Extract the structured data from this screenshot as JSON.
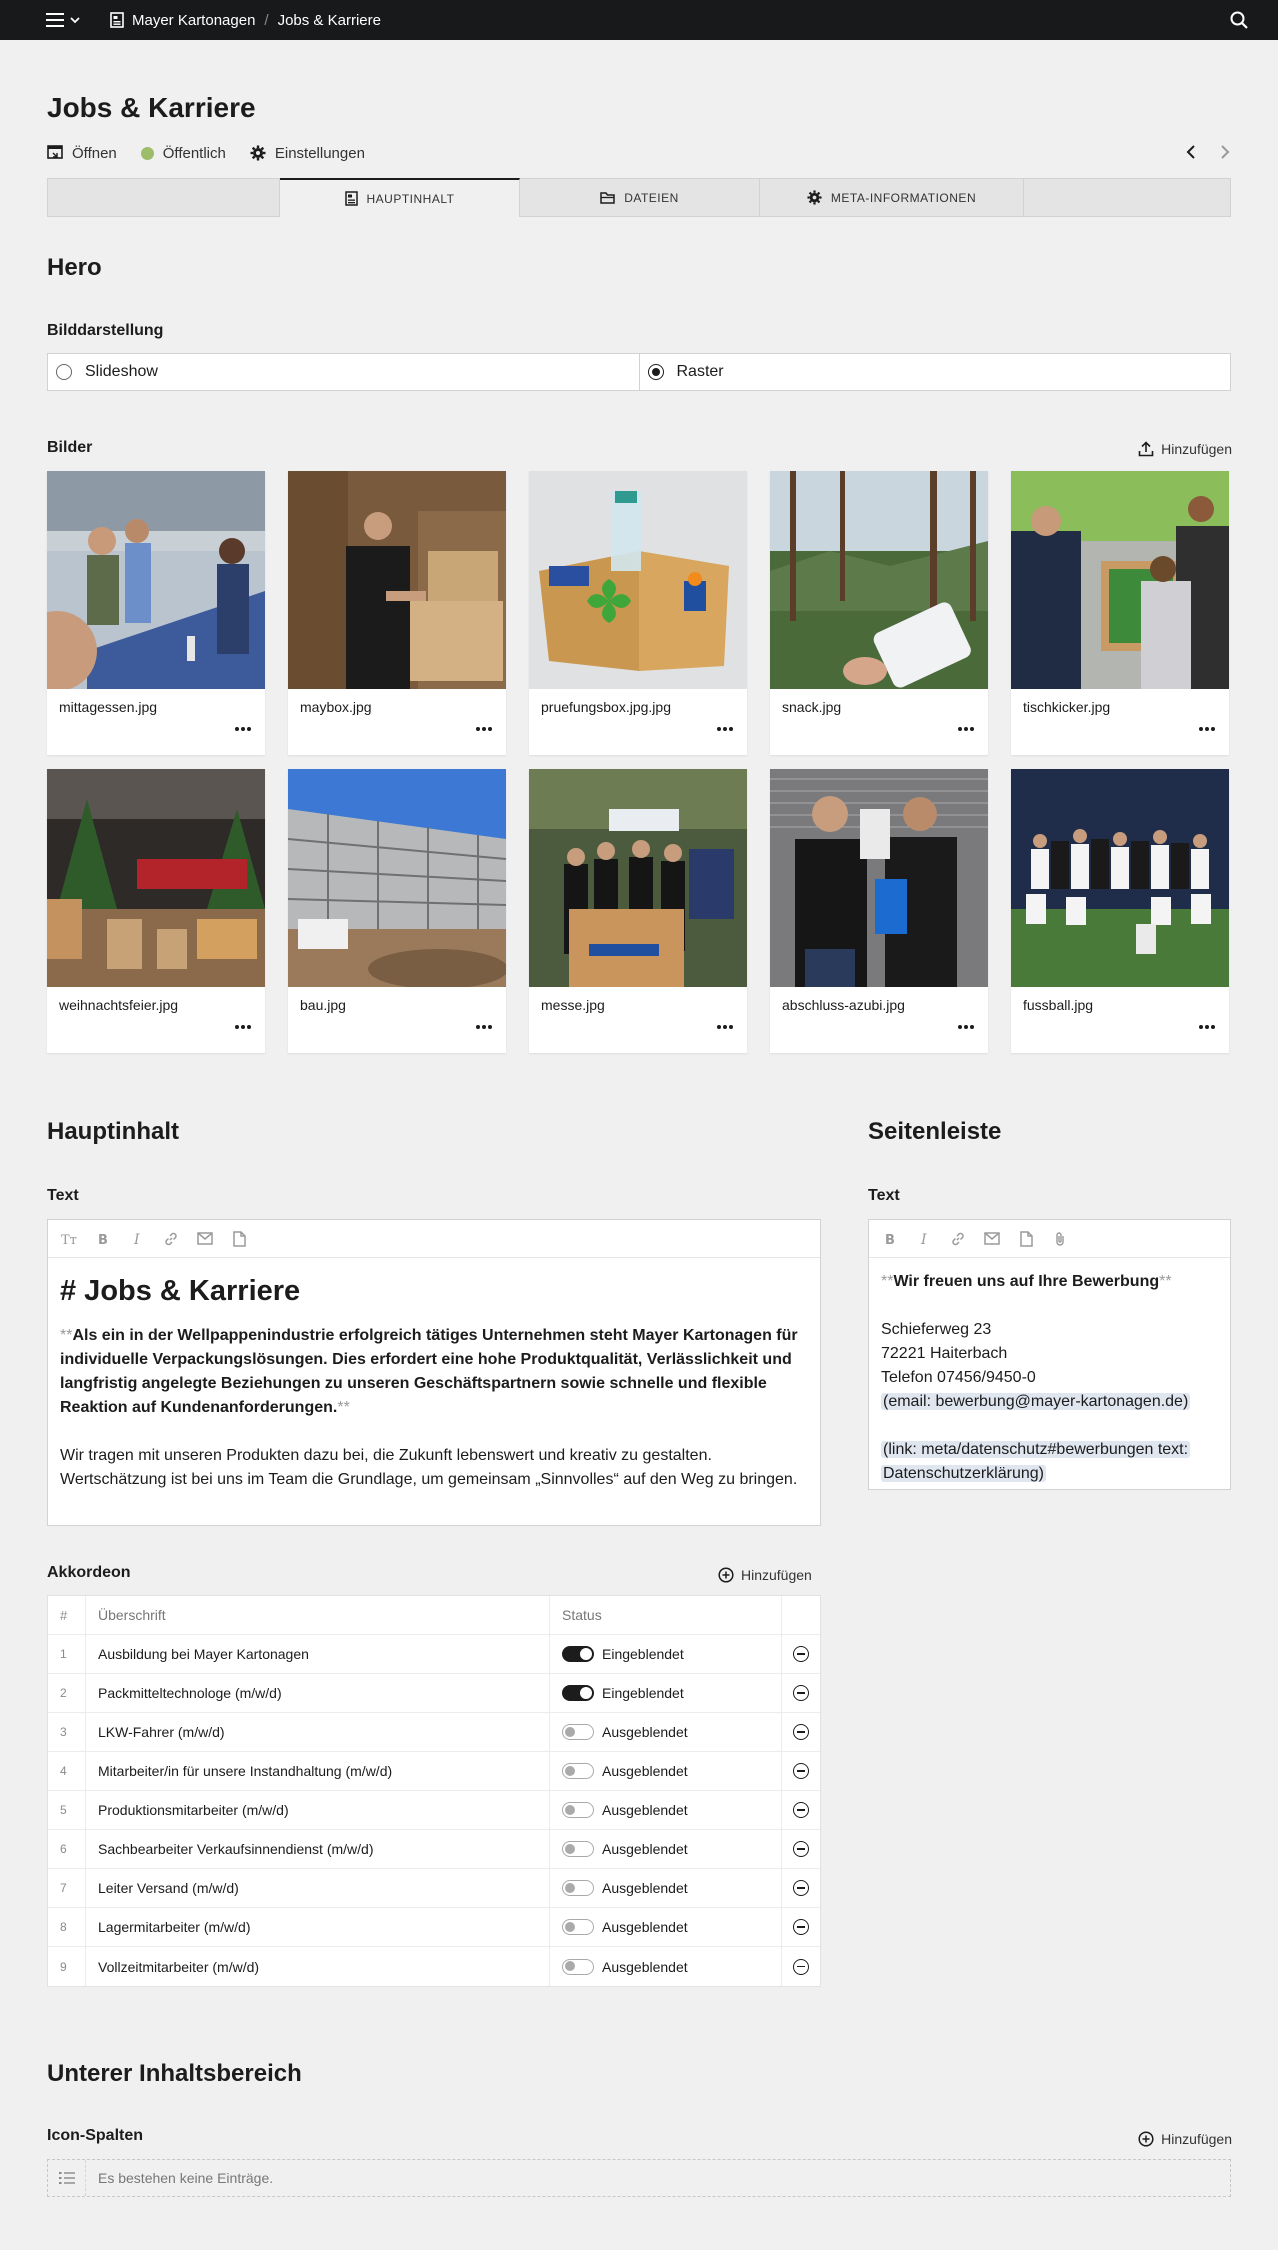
{
  "topbar": {
    "breadcrumb": [
      "Mayer Kartonagen",
      "Jobs & Karriere"
    ]
  },
  "page": {
    "title": "Jobs & Karriere",
    "actions": {
      "open": "Öffnen",
      "public": "Öffentlich",
      "settings": "Einstellungen"
    },
    "status_color": "#9dbd6b"
  },
  "tabs": [
    {
      "label": "HAUPTINHALT",
      "icon": "document-icon",
      "active": true
    },
    {
      "label": "DATEIEN",
      "icon": "folder-icon",
      "active": false
    },
    {
      "label": "META-INFORMATIONEN",
      "icon": "gear-icon",
      "active": false
    }
  ],
  "hero": {
    "section_title": "Hero",
    "display_label": "Bilddarstellung",
    "options": [
      "Slideshow",
      "Raster"
    ],
    "selected": "Raster",
    "images_label": "Bilder",
    "add_label": "Hinzufügen",
    "images": [
      "mittagessen.jpg",
      "maybox.jpg",
      "pruefungsbox.jpg.jpg",
      "snack.jpg",
      "tischkicker.jpg",
      "weihnachtsfeier.jpg",
      "bau.jpg",
      "messe.jpg",
      "abschluss-azubi.jpg",
      "fussball.jpg"
    ]
  },
  "main": {
    "section_title": "Hauptinhalt",
    "text_label": "Text",
    "heading": "# Jobs & Karriere",
    "bold_paragraph": "Als ein in der Wellpappenindustrie erfolgreich tätiges Unternehmen steht Mayer Kartonagen für individuelle Verpackungslösungen. Dies erfordert eine hohe Produktqualität, Verlässlichkeit und langfristig angelegte Beziehungen zu unseren Geschäftspartnern sowie schnelle und flexible Reaktion auf Kundenanforderungen.",
    "bold_marker": "**",
    "paragraph": "Wir tragen mit unseren Produkten dazu bei, die Zukunft lebenswert und kreativ zu gestalten. Wertschätzung ist bei uns im Team die Grundlage, um gemeinsam „Sinnvolles“ auf den Weg zu bringen."
  },
  "accordion": {
    "label": "Akkordeon",
    "add_label": "Hinzufügen",
    "columns": [
      "#",
      "Überschrift",
      "Status"
    ],
    "rows": [
      {
        "num": "1",
        "title": "Ausbildung bei Mayer Kartonagen",
        "status": "Eingeblendet",
        "on": true
      },
      {
        "num": "2",
        "title": "Packmitteltechnologe (m/w/d)",
        "status": "Eingeblendet",
        "on": true
      },
      {
        "num": "3",
        "title": "LKW-Fahrer (m/w/d)",
        "status": "Ausgeblendet",
        "on": false
      },
      {
        "num": "4",
        "title": "Mitarbeiter/in für unsere Instandhaltung (m/w/d)",
        "status": "Ausgeblendet",
        "on": false
      },
      {
        "num": "5",
        "title": "Produktionsmitarbeiter (m/w/d)",
        "status": "Ausgeblendet",
        "on": false
      },
      {
        "num": "6",
        "title": "Sachbearbeiter Verkaufsinnendienst (m/w/d)",
        "status": "Ausgeblendet",
        "on": false
      },
      {
        "num": "7",
        "title": "Leiter Versand (m/w/d)",
        "status": "Ausgeblendet",
        "on": false
      },
      {
        "num": "8",
        "title": "Lagermitarbeiter (m/w/d)",
        "status": "Ausgeblendet",
        "on": false
      },
      {
        "num": "9",
        "title": "Vollzeitmitarbeiter (m/w/d)",
        "status": "Ausgeblendet",
        "on": false
      }
    ]
  },
  "sidebar": {
    "section_title": "Seitenleiste",
    "text_label": "Text",
    "bold_line": "Wir freuen uns auf Ihre Bewerbung",
    "bold_marker": "**",
    "address": [
      "Schieferweg 23",
      "72221 Haiterbach",
      "Telefon 07456/9450-0"
    ],
    "email_tag": "(email: bewerbung@mayer-kartonagen.de)",
    "link_tag_line1": "(link: meta/datenschutz#bewerbungen text:",
    "link_tag_line2": "Datenschutzerklärung)"
  },
  "lower": {
    "section_title": "Unterer Inhaltsbereich",
    "icon_columns_label": "Icon-Spalten",
    "add_label": "Hinzufügen",
    "empty_text": "Es bestehen keine Einträge."
  }
}
